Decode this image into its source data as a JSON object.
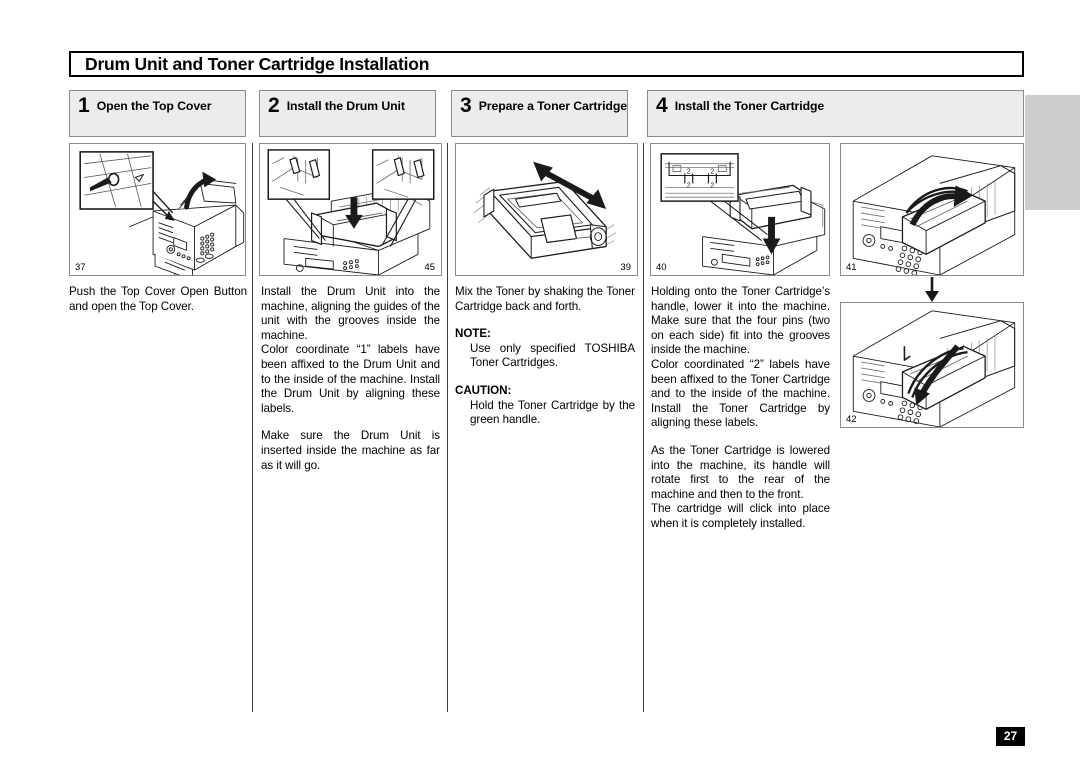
{
  "document": {
    "title": "Drum Unit and Toner Cartridge Installation",
    "page_number": "27"
  },
  "steps": [
    {
      "number": "1",
      "label": "Open the Top Cover"
    },
    {
      "number": "2",
      "label": "Install the Drum Unit"
    },
    {
      "number": "3",
      "label": "Prepare a Toner Cartridge"
    },
    {
      "number": "4",
      "label": "Install the Toner Cartridge"
    }
  ],
  "figures": [
    {
      "id": "37",
      "caption_position": "bottom-left",
      "depicts": "fax-machine-top-cover-open-button-detail"
    },
    {
      "id": "45",
      "caption_position": "bottom-right",
      "depicts": "drum-unit-insertion-with-guide-detail-insets"
    },
    {
      "id": "39",
      "caption_position": "bottom-right",
      "depicts": "toner-cartridge-shaking-arrow"
    },
    {
      "id": "40",
      "caption_position": "bottom-left",
      "depicts": "toner-cartridge-lowering-with-label-2-inset"
    },
    {
      "id": "41",
      "caption_position": "bottom-left",
      "depicts": "toner-cartridge-handle-rotating-rear"
    },
    {
      "id": "42",
      "caption_position": "bottom-left",
      "depicts": "toner-cartridge-handle-rotating-front"
    }
  ],
  "columns": [
    {
      "id": "step-1-text",
      "blocks": [
        {
          "type": "paragraph",
          "text": "Push the Top Cover Open Button and open the Top Cover."
        }
      ]
    },
    {
      "id": "step-2-text",
      "blocks": [
        {
          "type": "paragraph",
          "text": "Install the Drum Unit into the machine, aligning the guides of the unit with the grooves inside the machine."
        },
        {
          "type": "paragraph",
          "text": "Color coordinate “1” labels have been affixed to the Drum Unit and to the inside of the machine. Install the Drum Unit by aligning these labels."
        },
        {
          "type": "paragraph-gap",
          "text": "Make sure the Drum Unit is inserted inside the machine as far as it will go."
        }
      ]
    },
    {
      "id": "step-3-text",
      "blocks": [
        {
          "type": "paragraph",
          "text": "Mix the Toner by shaking the Toner Cartridge back and forth."
        },
        {
          "type": "label",
          "text": "NOTE:"
        },
        {
          "type": "indented",
          "text": "Use only specified TOSHIBA Toner Cartridges."
        },
        {
          "type": "label",
          "text": "CAUTION:"
        },
        {
          "type": "indented",
          "text": "Hold the Toner Cartridge by the green handle."
        }
      ]
    },
    {
      "id": "step-4-text",
      "blocks": [
        {
          "type": "paragraph",
          "text": "Holding onto the Toner Cartridge’s handle, lower it into the machine. Make sure that the four pins (two on each side) fit into the grooves inside the machine."
        },
        {
          "type": "paragraph",
          "text": "Color coordinated “2” labels have been affixed to the Toner Cartridge and to the inside of the machine. Install the Toner Cartridge by aligning these labels."
        },
        {
          "type": "paragraph-gap",
          "text": "As the Toner Cartridge is lowered into the machine, its handle will rotate first to the rear of the machine and then to the front."
        },
        {
          "type": "paragraph",
          "text": "The cartridge will click into place when it is completely installed."
        }
      ]
    }
  ],
  "colors": {
    "header_fill": "#ececec",
    "border": "#8a8a8a",
    "divider": "#3a3a3a",
    "thumb_tab": "#cccccc",
    "page_number_bg": "#000000"
  }
}
